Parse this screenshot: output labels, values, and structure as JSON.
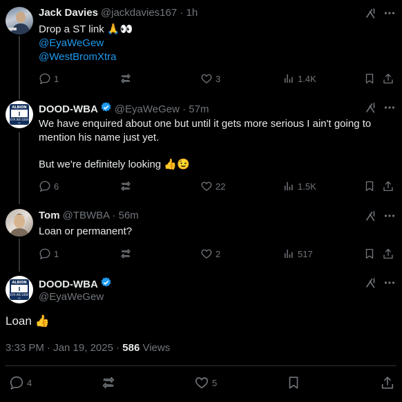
{
  "thread": [
    {
      "name": "Jack Davies",
      "handle": "@jackdavies167 · 1h",
      "text_line1": "Drop a ST link 🙏👀",
      "mentions": [
        "@EyaWeGew",
        "@WestBromXtra"
      ],
      "replies": "1",
      "likes": "3",
      "views": "1.4K"
    },
    {
      "name": "DOOD-WBA",
      "handle": "@EyaWeGew · 57m",
      "text_line1": "We have enquired about one but until it gets more serious I ain't going to",
      "text_line2": "mention his name just yet.",
      "text_line3": "But we're definitely looking 👍😉",
      "replies": "6",
      "likes": "22",
      "views": "1.5K"
    },
    {
      "name": "Tom",
      "handle": "@TBWBA · 56m",
      "text_line1": "Loan or permanent?",
      "replies": "1",
      "likes": "2",
      "views": "517"
    }
  ],
  "main": {
    "name": "DOOD-WBA",
    "handle": "@EyaWeGew",
    "text": "Loan 👍",
    "timestamp": "3:33 PM · Jan 19, 2025 · ",
    "views_count": "586",
    "views_label": " Views",
    "replies": "4",
    "likes": "5"
  },
  "avatar_text": {
    "top": "ALBION",
    "middle": "EYA WE GEW",
    "bottom": "FC"
  },
  "colors": {
    "background": "#000000",
    "text": "#e7e9ea",
    "muted": "#71767b",
    "link": "#1d9bf0",
    "verified": "#1d9bf0",
    "divider": "#2f3336"
  }
}
